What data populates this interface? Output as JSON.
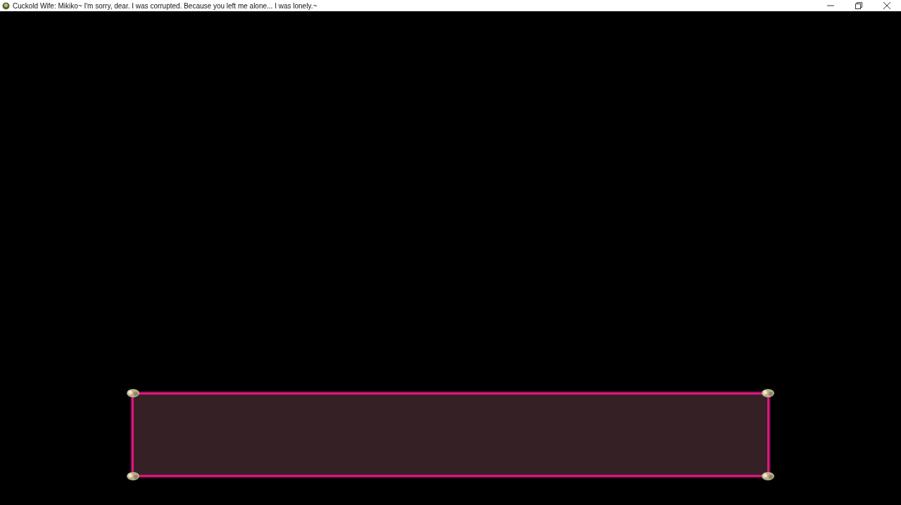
{
  "window": {
    "title": "Cuckold Wife: Mikiko~ I'm sorry, dear. I was corrupted. Because you left me alone... I was lonely.~"
  }
}
